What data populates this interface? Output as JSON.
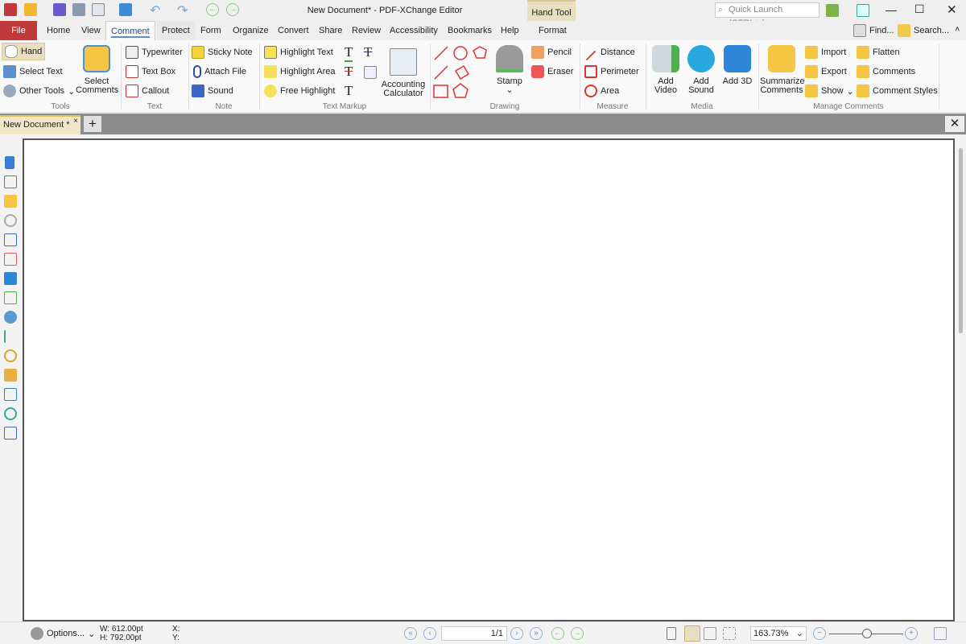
{
  "window": {
    "title": "New Document* - PDF-XChange Editor",
    "quick_launch_placeholder": "Quick Launch (CTRL+.)",
    "context_tab_group": "Hand Tool"
  },
  "tabs": [
    "File",
    "Home",
    "View",
    "Comment",
    "Protect",
    "Form",
    "Organize",
    "Convert",
    "Share",
    "Review",
    "Accessibility",
    "Bookmarks",
    "Help",
    "Format"
  ],
  "active_tab": "Comment",
  "right_tools": {
    "find": "Find...",
    "search": "Search..."
  },
  "ribbon": {
    "tools": {
      "label": "Tools",
      "hand": "Hand",
      "select_text": "Select Text",
      "other_tools": "Other Tools",
      "select_comments": "Select Comments"
    },
    "text": {
      "label": "Text",
      "typewriter": "Typewriter",
      "text_box": "Text Box",
      "callout": "Callout"
    },
    "note": {
      "label": "Note",
      "sticky_note": "Sticky Note",
      "attach_file": "Attach File",
      "sound": "Sound"
    },
    "text_markup": {
      "label": "Text Markup",
      "highlight_text": "Highlight Text",
      "highlight_area": "Highlight Area",
      "free_highlight": "Free Highlight",
      "accounting_calculator": "Accounting Calculator"
    },
    "drawing": {
      "label": "Drawing",
      "stamp": "Stamp",
      "pencil": "Pencil",
      "eraser": "Eraser"
    },
    "measure": {
      "label": "Measure",
      "distance": "Distance",
      "perimeter": "Perimeter",
      "area": "Area"
    },
    "media": {
      "label": "Media",
      "add_video": "Add Video",
      "add_sound": "Add Sound",
      "add_3d": "Add 3D"
    },
    "manage": {
      "label": "Manage Comments",
      "summarize": "Summarize Comments",
      "import": "Import",
      "export": "Export",
      "show": "Show",
      "flatten": "Flatten",
      "comments": "Comments",
      "comment_styles": "Comment Styles"
    }
  },
  "document_tab": {
    "label": "New Document *"
  },
  "status": {
    "options": "Options...",
    "width": "W: 612.00pt",
    "height": "H: 792.00pt",
    "x": "X:",
    "y": "Y:",
    "page": "1/1",
    "zoom": "163.73%"
  },
  "colors": {
    "file_tab": "#c0393b",
    "context_tab": "#e8dfc0",
    "doc_tab_bar": "#8c8c8c",
    "accent": "#1a4f8a"
  }
}
